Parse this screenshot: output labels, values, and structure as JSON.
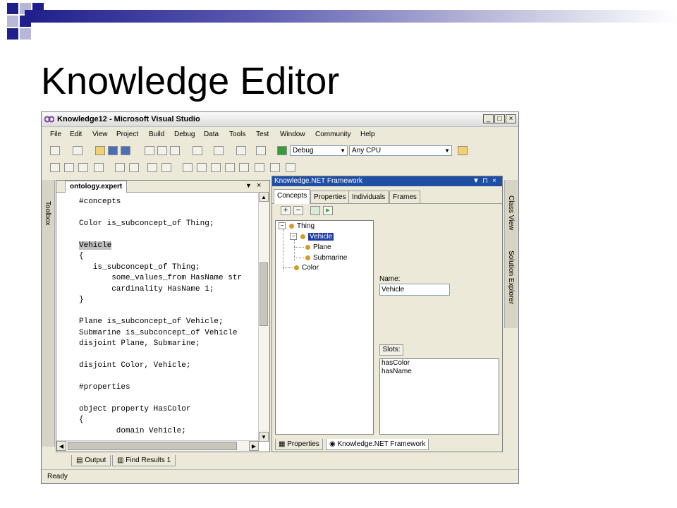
{
  "slide": {
    "title": "Knowledge Editor"
  },
  "window": {
    "title": "Knowledge12 - Microsoft Visual Studio",
    "menu": [
      "File",
      "Edit",
      "View",
      "Project",
      "Build",
      "Debug",
      "Data",
      "Tools",
      "Test",
      "Window",
      "Community",
      "Help"
    ],
    "toolbar": {
      "configuration": "Debug",
      "platform": "Any CPU"
    },
    "left_strip_label": "Toolbox",
    "right_strip_labels": [
      "Class View",
      "Solution Explorer"
    ],
    "editor": {
      "tab": "ontology.expert",
      "lines": [
        "#concepts",
        "",
        "Color is_subconcept_of Thing;",
        "",
        "Vehicle",
        "{",
        "   is_subconcept_of Thing;",
        "       some_values_from HasName str",
        "       cardinality HasName 1;",
        "}",
        "",
        "Plane is_subconcept_of Vehicle;",
        "Submarine is_subconcept_of Vehicle",
        "disjoint Plane, Submarine;",
        "",
        "disjoint Color, Vehicle;",
        "",
        "#properties",
        "",
        "object property HasColor",
        "{",
        "        domain Vehicle;"
      ]
    },
    "kpanel": {
      "title": "Knowledge.NET Framework",
      "tabs": [
        "Concepts",
        "Properties",
        "Individuals",
        "Frames"
      ],
      "tree": {
        "root": "Thing",
        "selected": "Vehicle",
        "children_of_vehicle": [
          "Plane",
          "Submarine"
        ],
        "other": "Color"
      },
      "name_label": "Name:",
      "name_value": "Vehicle",
      "slots_label": "Slots:",
      "slots": [
        "hasColor",
        "hasName"
      ],
      "bottom_tabs": [
        "Properties",
        "Knowledge.NET Framework"
      ]
    },
    "output_tabs": [
      "Output",
      "Find Results 1"
    ],
    "status": "Ready"
  }
}
